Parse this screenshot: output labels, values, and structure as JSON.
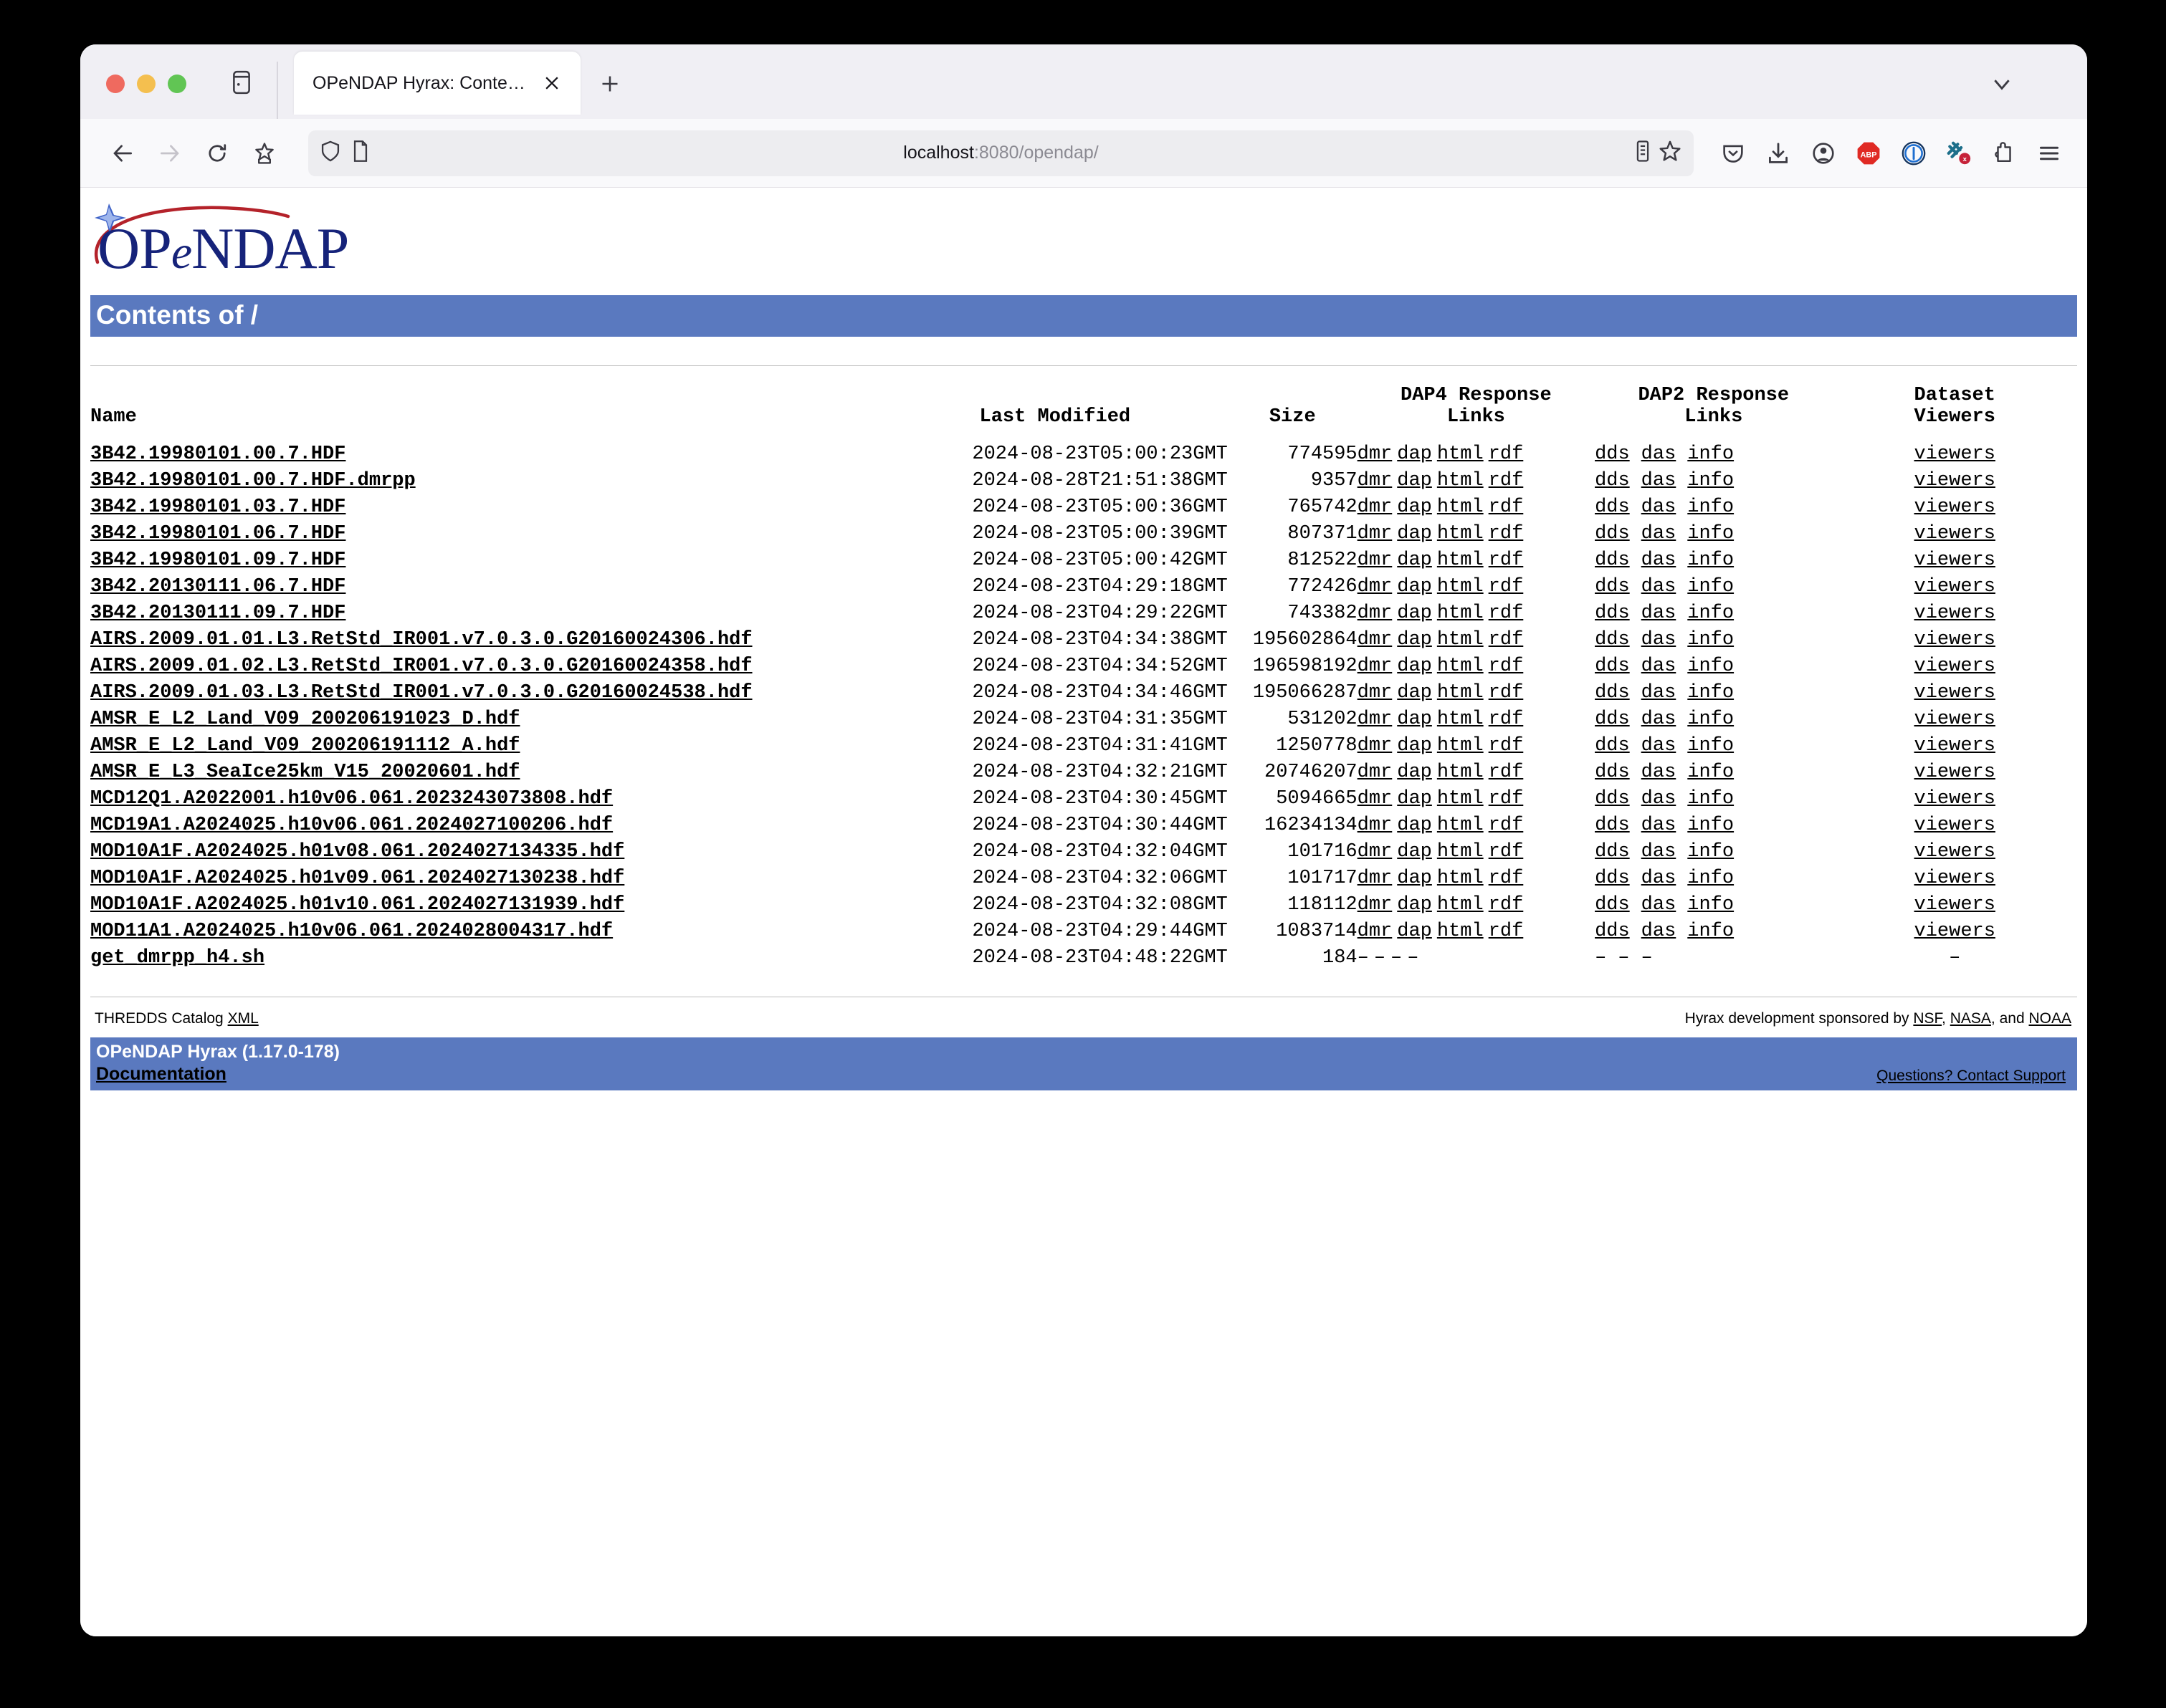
{
  "browser": {
    "tab_title": "OPeNDAP Hyrax: Contents of /",
    "url_host": "localhost",
    "url_rest": ":8080/opendap/",
    "icons": {
      "sidebar": "sidebar-icon",
      "close_tab": "close-icon",
      "new_tab": "plus-icon",
      "tab_list": "chevron-down-icon",
      "back": "back-arrow-icon",
      "forward": "forward-arrow-icon",
      "reload": "reload-icon",
      "bookmark_page": "bookmark-star-icon",
      "shield": "shield-icon",
      "page_doc": "document-icon",
      "reader": "reader-view-icon",
      "star": "star-icon",
      "pocket": "pocket-icon",
      "downloads": "download-icon",
      "account": "account-icon",
      "adblock": "abp-icon",
      "privacy_badger": "privacy-badger-icon",
      "noscript": "noscript-icon",
      "extensions": "extensions-puzzle-icon",
      "menu": "hamburger-menu-icon"
    }
  },
  "site": {
    "logo_text_1": "OP",
    "logo_text_e": "e",
    "logo_text_2": "NDAP",
    "banner_title": "Contents of /"
  },
  "table": {
    "headers": {
      "name": "Name",
      "last_modified": "Last Modified",
      "size": "Size",
      "dap4_l1": "DAP4 Response",
      "dap4_l2": "Links",
      "dap2_l1": "DAP2 Response",
      "dap2_l2": "Links",
      "viewers_l1": "Dataset",
      "viewers_l2": "Viewers"
    },
    "dap4_links": [
      "dmr",
      "dap",
      "html",
      "rdf"
    ],
    "dap2_links": [
      "dds",
      "das",
      "info"
    ],
    "viewer_link": "viewers",
    "dash": "–",
    "rows": [
      {
        "name": "3B42.19980101.00.7.HDF",
        "modified": "2024-08-23T05:00:23GMT",
        "size": "774595",
        "links": true
      },
      {
        "name": "3B42.19980101.00.7.HDF.dmrpp",
        "modified": "2024-08-28T21:51:38GMT",
        "size": "9357",
        "links": true
      },
      {
        "name": "3B42.19980101.03.7.HDF",
        "modified": "2024-08-23T05:00:36GMT",
        "size": "765742",
        "links": true
      },
      {
        "name": "3B42.19980101.06.7.HDF",
        "modified": "2024-08-23T05:00:39GMT",
        "size": "807371",
        "links": true
      },
      {
        "name": "3B42.19980101.09.7.HDF",
        "modified": "2024-08-23T05:00:42GMT",
        "size": "812522",
        "links": true
      },
      {
        "name": "3B42.20130111.06.7.HDF",
        "modified": "2024-08-23T04:29:18GMT",
        "size": "772426",
        "links": true
      },
      {
        "name": "3B42.20130111.09.7.HDF",
        "modified": "2024-08-23T04:29:22GMT",
        "size": "743382",
        "links": true
      },
      {
        "name": "AIRS.2009.01.01.L3.RetStd_IR001.v7.0.3.0.G20160024306.hdf",
        "modified": "2024-08-23T04:34:38GMT",
        "size": "195602864",
        "links": true
      },
      {
        "name": "AIRS.2009.01.02.L3.RetStd_IR001.v7.0.3.0.G20160024358.hdf",
        "modified": "2024-08-23T04:34:52GMT",
        "size": "196598192",
        "links": true
      },
      {
        "name": "AIRS.2009.01.03.L3.RetStd_IR001.v7.0.3.0.G20160024538.hdf",
        "modified": "2024-08-23T04:34:46GMT",
        "size": "195066287",
        "links": true
      },
      {
        "name": "AMSR_E_L2_Land_V09_200206191023_D.hdf",
        "modified": "2024-08-23T04:31:35GMT",
        "size": "531202",
        "links": true
      },
      {
        "name": "AMSR_E_L2_Land_V09_200206191112_A.hdf",
        "modified": "2024-08-23T04:31:41GMT",
        "size": "1250778",
        "links": true
      },
      {
        "name": "AMSR_E_L3_SeaIce25km_V15_20020601.hdf",
        "modified": "2024-08-23T04:32:21GMT",
        "size": "20746207",
        "links": true
      },
      {
        "name": "MCD12Q1.A2022001.h10v06.061.2023243073808.hdf",
        "modified": "2024-08-23T04:30:45GMT",
        "size": "5094665",
        "links": true
      },
      {
        "name": "MCD19A1.A2024025.h10v06.061.2024027100206.hdf",
        "modified": "2024-08-23T04:30:44GMT",
        "size": "16234134",
        "links": true
      },
      {
        "name": "MOD10A1F.A2024025.h01v08.061.2024027134335.hdf",
        "modified": "2024-08-23T04:32:04GMT",
        "size": "101716",
        "links": true
      },
      {
        "name": "MOD10A1F.A2024025.h01v09.061.2024027130238.hdf",
        "modified": "2024-08-23T04:32:06GMT",
        "size": "101717",
        "links": true
      },
      {
        "name": "MOD10A1F.A2024025.h01v10.061.2024027131939.hdf",
        "modified": "2024-08-23T04:32:08GMT",
        "size": "118112",
        "links": true
      },
      {
        "name": "MOD11A1.A2024025.h10v06.061.2024028004317.hdf",
        "modified": "2024-08-23T04:29:44GMT",
        "size": "1083714",
        "links": true
      },
      {
        "name": "get_dmrpp_h4.sh",
        "modified": "2024-08-23T04:48:22GMT",
        "size": "184",
        "links": false
      }
    ]
  },
  "footer": {
    "thredds_text": "THREDDS Catalog",
    "thredds_link": "XML",
    "sponsor_prefix": "Hyrax development sponsored by",
    "sponsor_nsf": "NSF",
    "sponsor_sep1": ",",
    "sponsor_nasa": "NASA",
    "sponsor_sep2": ", and",
    "sponsor_noaa": "NOAA",
    "version": "OPeNDAP Hyrax (1.17.0-178)",
    "documentation": "Documentation",
    "support": "Questions? Contact Support"
  },
  "colors": {
    "banner_blue": "#5a79bf",
    "logo_navy": "#16237a",
    "logo_red": "#b4222a",
    "chrome_grey": "#f0eff4"
  }
}
